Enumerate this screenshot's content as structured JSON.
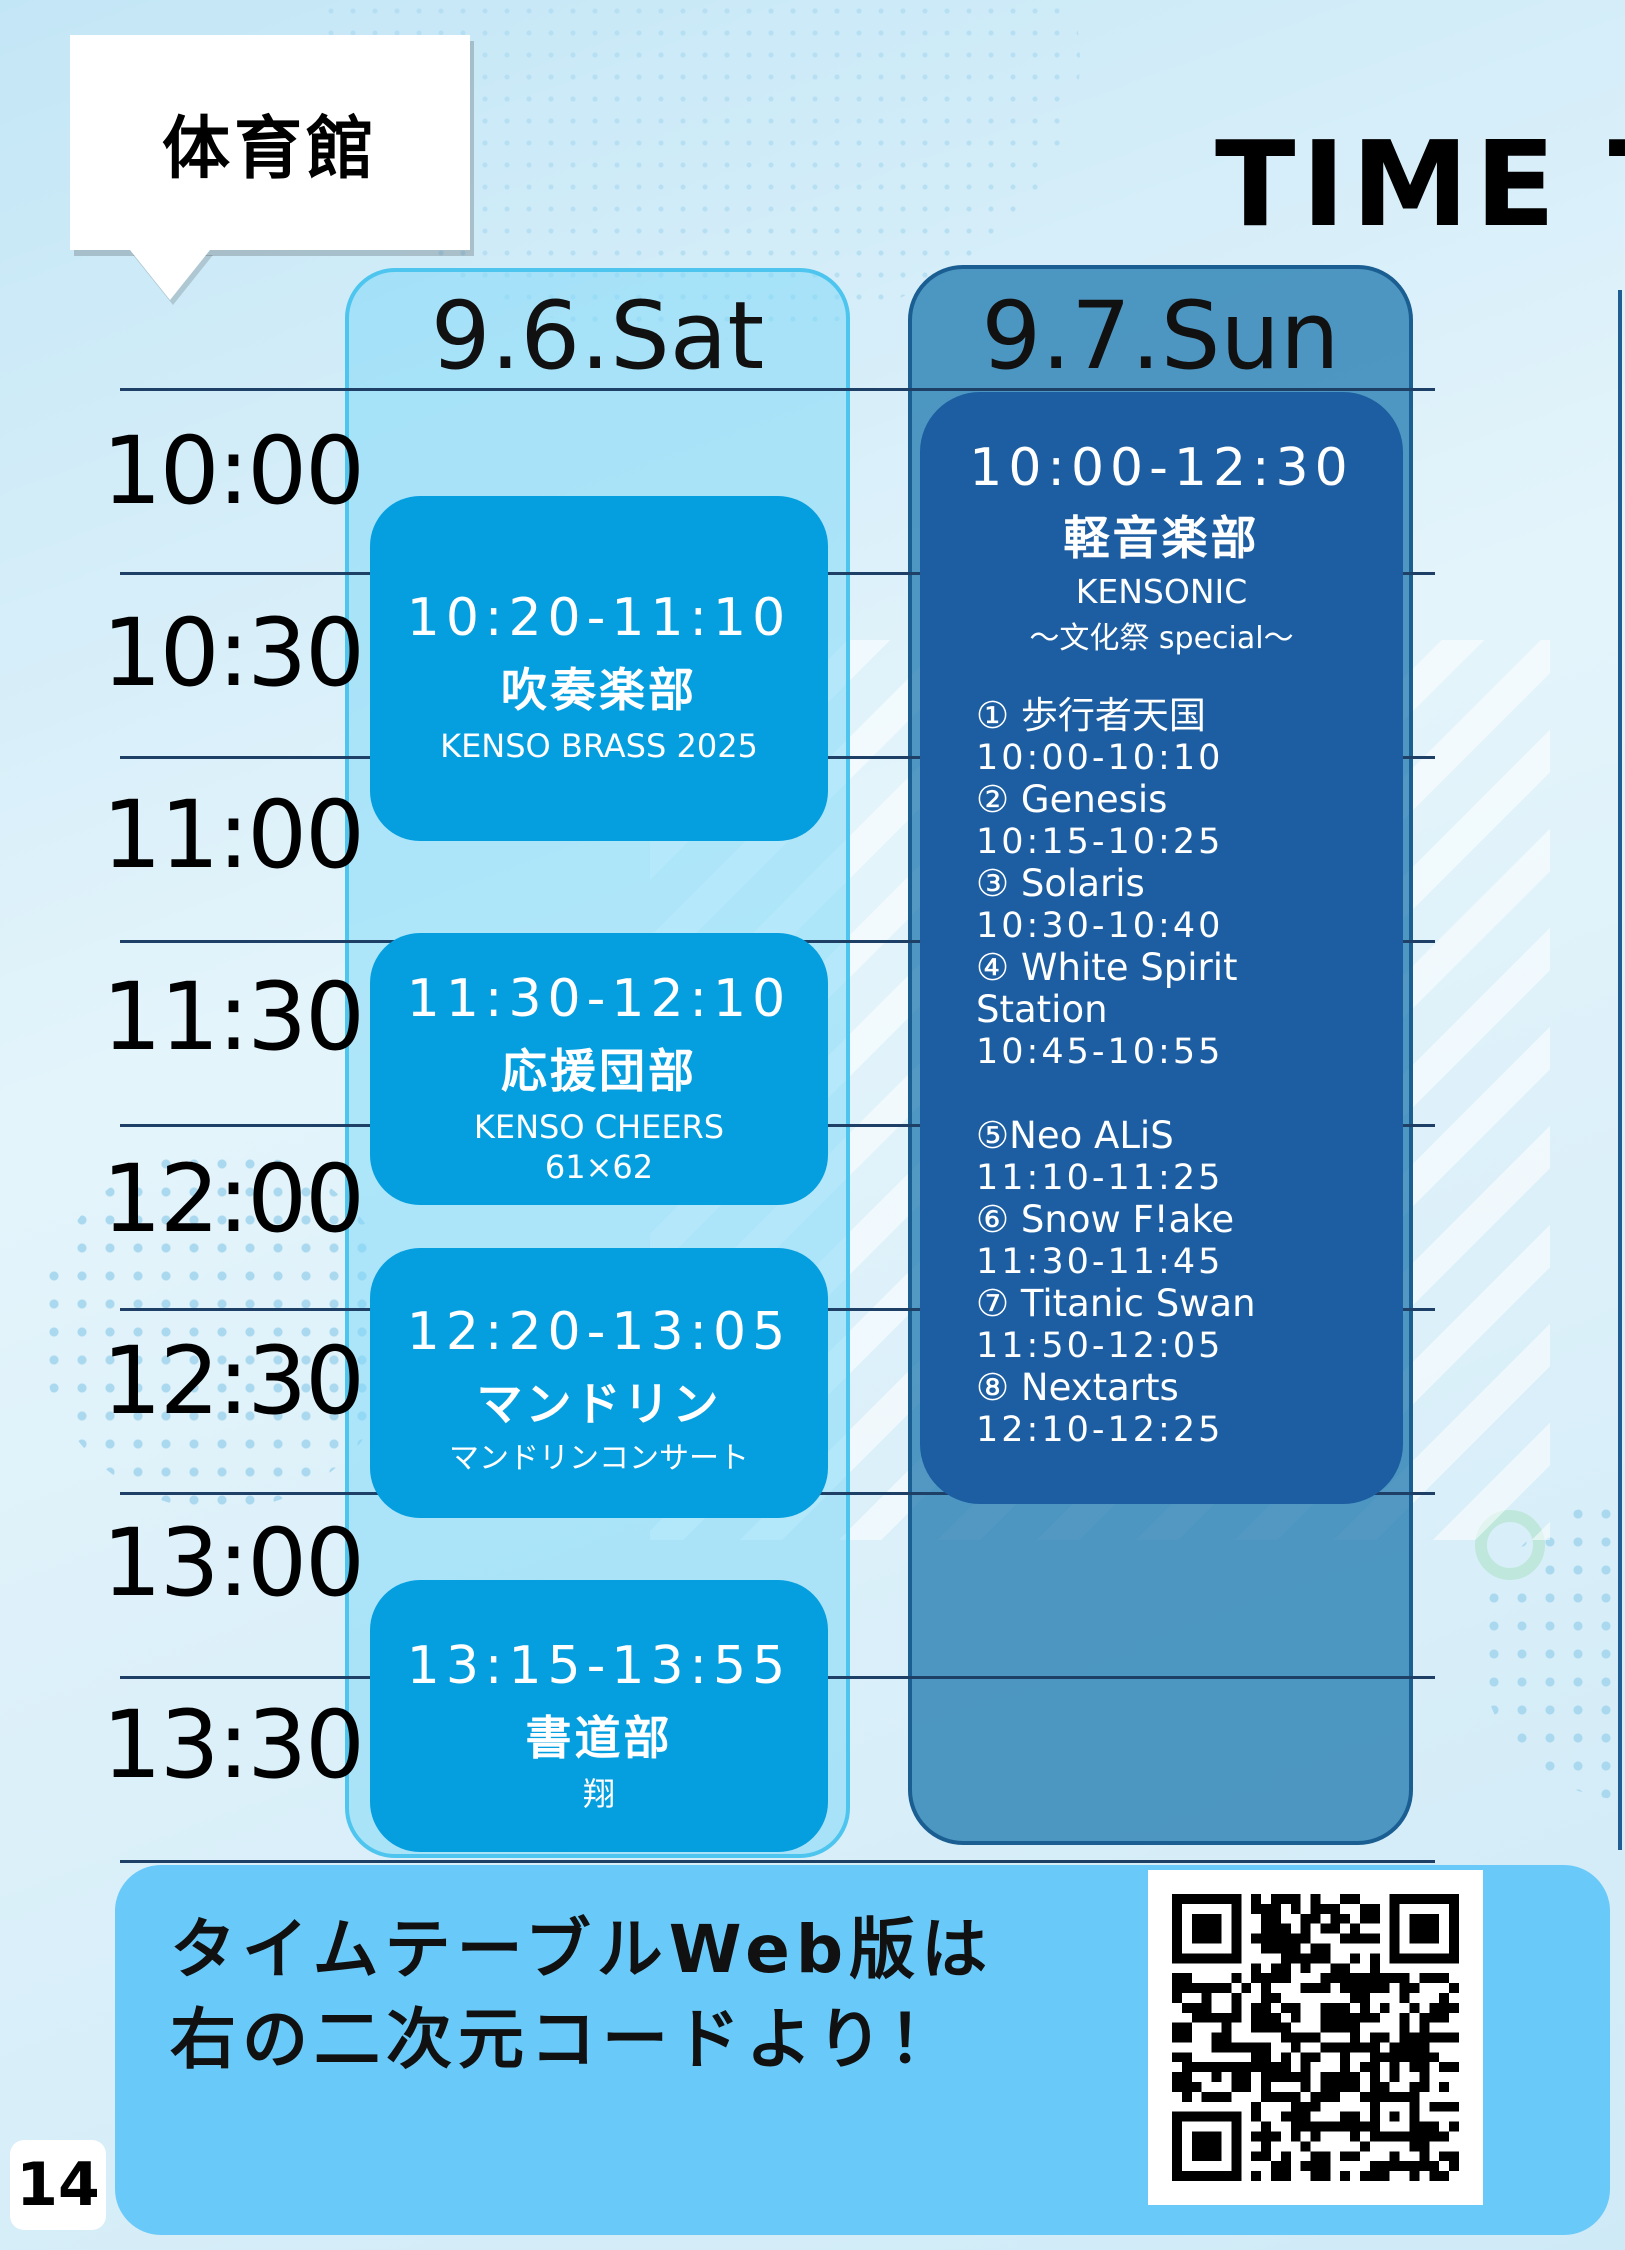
{
  "page": {
    "venue": "体育館",
    "title": "TIME T",
    "page_number": "14"
  },
  "timeline": {
    "labels": [
      "10:00",
      "10:30",
      "11:00",
      "11:30",
      "12:00",
      "12:30",
      "13:00",
      "13:30"
    ]
  },
  "saturday": {
    "date_label": "9.6.Sat",
    "events": [
      {
        "time": "10:20-11:10",
        "name": "吹奏楽部",
        "sub": "KENSO BRASS 2025"
      },
      {
        "time": "11:30-12:10",
        "name": "応援団部",
        "sub": "KENSO CHEERS",
        "sub2": "61×62"
      },
      {
        "time": "12:20-13:05",
        "name": "マンドリン",
        "sub": "マンドリンコンサート"
      },
      {
        "time": "13:15-13:55",
        "name": "書道部",
        "sub": "翔"
      }
    ]
  },
  "sunday": {
    "date_label": "9.7.Sun",
    "block": {
      "time": "10:00-12:30",
      "name": "軽音楽部",
      "sub": "KENSONIC",
      "sub2": "～文化祭 special～",
      "acts": [
        {
          "name": "① 歩行者天国",
          "time": "10:00-10:10"
        },
        {
          "name": "② Genesis",
          "time": "10:15-10:25"
        },
        {
          "name": "③ Solaris",
          "time": "10:30-10:40"
        },
        {
          "name": "④ White Spirit Station",
          "time": "10:45-10:55"
        },
        {
          "name": "⑤Neo ALiS",
          "time": "11:10-11:25"
        },
        {
          "name": "⑥ Snow F!ake",
          "time": "11:30-11:45"
        },
        {
          "name": "⑦ Titanic Swan",
          "time": "11:50-12:05"
        },
        {
          "name": "⑧ Nextarts",
          "time": "12:10-12:25"
        }
      ]
    }
  },
  "banner": {
    "line1": "タイムテーブルWeb版は",
    "line2": "右の二次元コードより！"
  },
  "icons": {
    "qr": "qr-code-icon"
  }
}
